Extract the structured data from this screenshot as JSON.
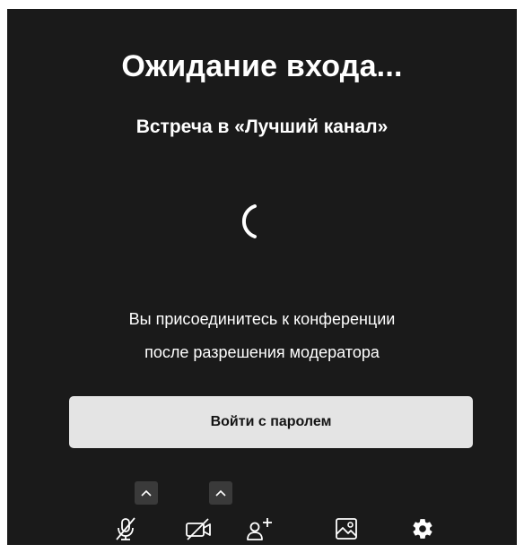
{
  "prejoin": {
    "title": "Ожидание входа...",
    "subtitle": "Встреча в «Лучший канал»",
    "message_line1": "Вы присоединитесь к конференции",
    "message_line2": "после разрешения модератора",
    "join_with_password_label": "Войти с паролем"
  },
  "toolbar": {
    "items": [
      {
        "icon": "microphone-muted-icon",
        "has_options_caret": true
      },
      {
        "icon": "camera-off-icon",
        "has_options_caret": true
      },
      {
        "icon": "invite-people-icon",
        "has_options_caret": false
      },
      {
        "icon": "background-image-icon",
        "has_options_caret": false
      },
      {
        "icon": "settings-gear-icon",
        "has_options_caret": false
      }
    ]
  },
  "colors": {
    "panel_background": "#1a1a1a",
    "text": "#ffffff",
    "button_background": "#e4e4e4",
    "button_text": "#141414",
    "caret_background": "#3a3a3a"
  }
}
